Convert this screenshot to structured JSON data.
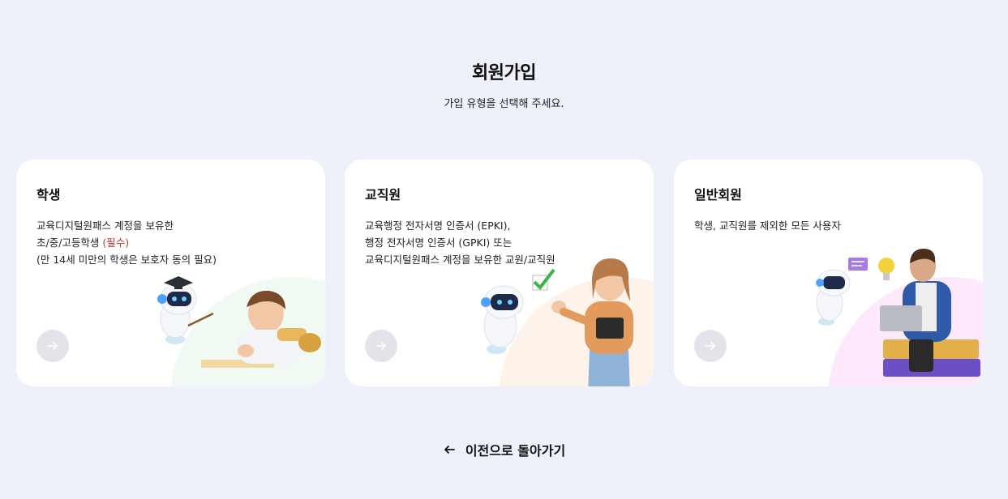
{
  "header": {
    "title": "회원가입",
    "subtitle": "가입 유형을 선택해 주세요."
  },
  "cards": [
    {
      "title": "학생",
      "desc_lines": [
        "교육디지털원패스 계정을 보유한",
        "초/중/고등학생",
        "(만 14세 미만의 학생은 보호자 동의 필요)"
      ],
      "required_label": "(필수)",
      "accent": "#f0faf2",
      "icon": "arrow-right-icon"
    },
    {
      "title": "교직원",
      "desc_lines": [
        "교육행정 전자서명 인증서 (EPKI),",
        "행정 전자서명 인증서 (GPKI) 또는",
        "교육디지털원패스 계정을 보유한 교원/교직원"
      ],
      "accent": "#fdf3ea",
      "icon": "arrow-right-icon"
    },
    {
      "title": "일반회원",
      "desc_lines": [
        "학생, 교직원를 제외한 모든 사용자"
      ],
      "accent": "#fde9fb",
      "icon": "arrow-right-icon"
    }
  ],
  "footer": {
    "back_label": "이전으로 돌아가기",
    "back_icon": "arrow-left-icon"
  }
}
